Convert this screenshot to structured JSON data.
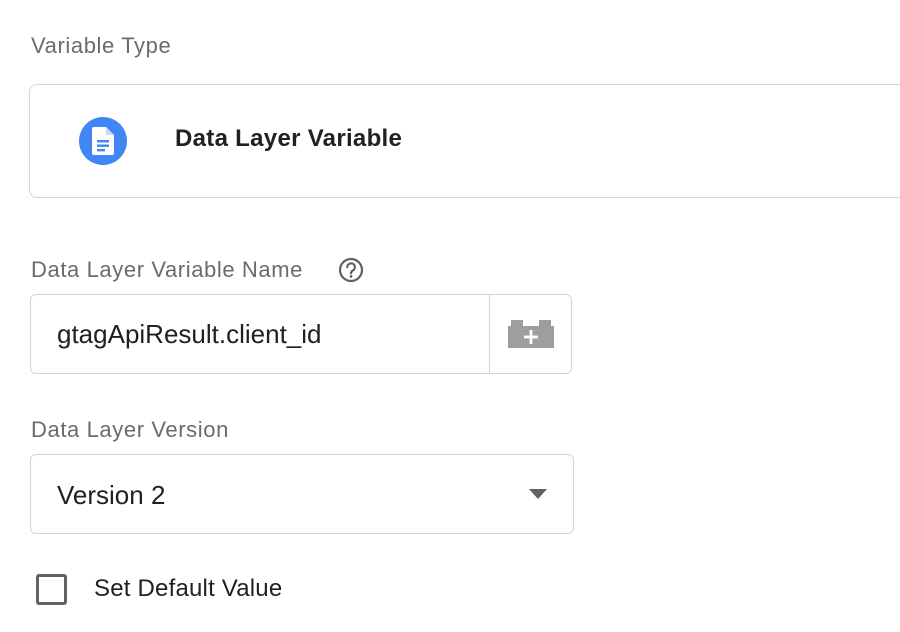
{
  "variable_type": {
    "section_label": "Variable Type",
    "selected_type": "Data Layer Variable",
    "icon": "document-icon",
    "icon_color": "#4285f4"
  },
  "variable_name": {
    "label": "Data Layer Variable Name",
    "help_icon": "help-circle-icon",
    "value": "gtagApiResult.client_id",
    "picker_icon": "variable-brick-plus-icon"
  },
  "version": {
    "label": "Data Layer Version",
    "selected": "Version 2",
    "icon": "caret-down-icon"
  },
  "default_value": {
    "label": "Set Default Value",
    "checked": false
  }
}
